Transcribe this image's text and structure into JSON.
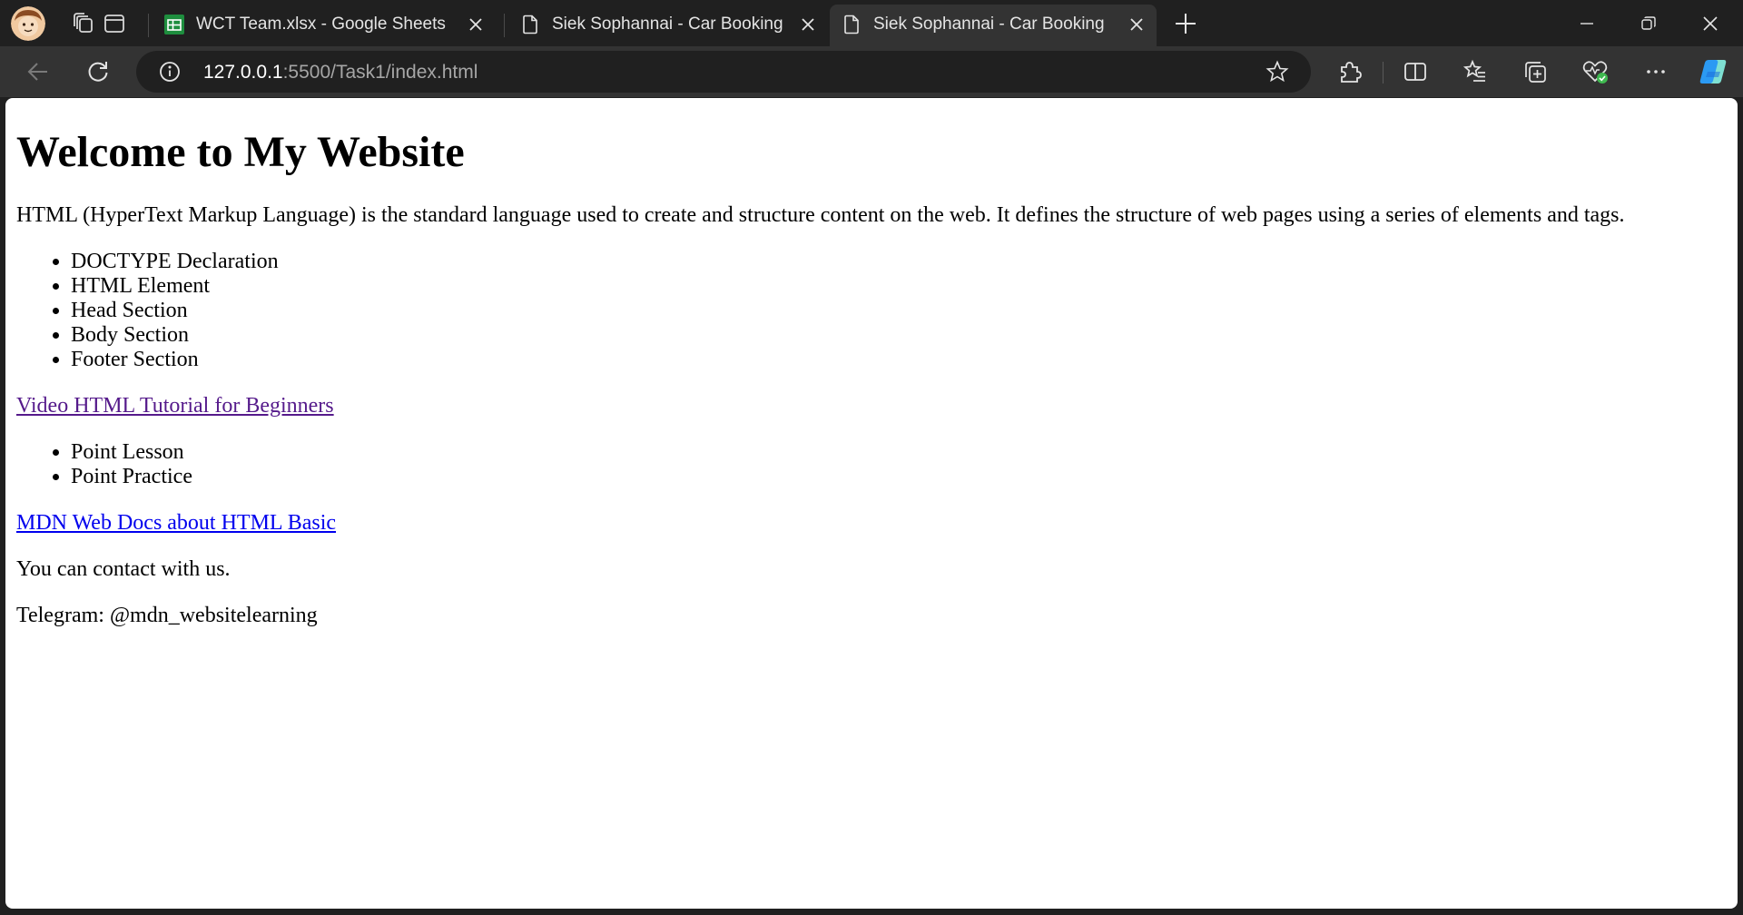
{
  "tabs": [
    {
      "title": "WCT Team.xlsx - Google Sheets",
      "favicon": "google-sheets-icon",
      "active": false
    },
    {
      "title": "Siek Sophannai - Car Booking",
      "favicon": "page-icon",
      "active": false
    },
    {
      "title": "Siek Sophannai - Car Booking",
      "favicon": "page-icon",
      "active": true
    }
  ],
  "address_bar": {
    "host": "127.0.0.1",
    "path": ":5500/Task1/index.html"
  },
  "colors": {
    "chrome_dark": "#202020",
    "toolbar": "#333333",
    "link": "#0000ee",
    "link_visited": "#551a8b",
    "sheets_green": "#1e8e3e"
  },
  "page": {
    "heading": "Welcome to My Website",
    "intro": "HTML (HyperText Markup Language) is the standard language used to create and structure content on the web. It defines the structure of web pages using a series of elements and tags.",
    "structure_list": [
      "DOCTYPE Declaration",
      "HTML Element",
      "Head Section",
      "Body Section",
      "Footer Section"
    ],
    "video_link": "Video HTML Tutorial for Beginners",
    "points_list": [
      "Point Lesson",
      "Point Practice"
    ],
    "mdn_link": "MDN Web Docs about HTML Basic",
    "contact_text": "You can contact with us.",
    "telegram_text": "Telegram: @mdn_websitelearning"
  }
}
